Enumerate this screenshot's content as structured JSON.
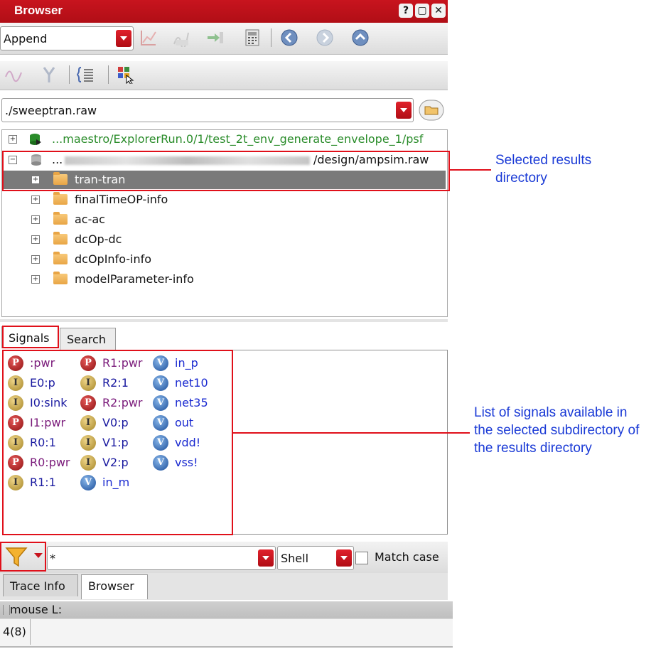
{
  "window": {
    "title": "Browser"
  },
  "title_buttons": [
    "?",
    "▢",
    "✕"
  ],
  "toolbar1": {
    "mode_value": "Append"
  },
  "path_combo": {
    "value": "./sweeptran.raw"
  },
  "tree": {
    "rows": [
      {
        "label": "...maestro/ExplorerRun.0/1/test_2t_env_generate_envelope_1/psf"
      },
      {
        "prefix": "...",
        "label": "/design/ampsim.raw"
      },
      {
        "label": "tran-tran"
      },
      {
        "label": "finalTimeOP-info"
      },
      {
        "label": "ac-ac"
      },
      {
        "label": "dcOp-dc"
      },
      {
        "label": "dcOpInfo-info"
      },
      {
        "label": "modelParameter-info"
      }
    ]
  },
  "tabs": {
    "signals": "Signals",
    "search": "Search"
  },
  "signals": {
    "col1": [
      {
        "type": "P",
        "name": ":pwr"
      },
      {
        "type": "I",
        "name": "E0:p"
      },
      {
        "type": "I",
        "name": "I0:sink"
      },
      {
        "type": "P",
        "name": "I1:pwr"
      },
      {
        "type": "I",
        "name": "R0:1"
      },
      {
        "type": "P",
        "name": "R0:pwr"
      },
      {
        "type": "I",
        "name": "R1:1"
      }
    ],
    "col2": [
      {
        "type": "P",
        "name": "R1:pwr"
      },
      {
        "type": "I",
        "name": "R2:1"
      },
      {
        "type": "P",
        "name": "R2:pwr"
      },
      {
        "type": "I",
        "name": "V0:p"
      },
      {
        "type": "I",
        "name": "V1:p"
      },
      {
        "type": "I",
        "name": "V2:p"
      },
      {
        "type": "V",
        "name": "in_m"
      }
    ],
    "col3": [
      {
        "type": "V",
        "name": "in_p"
      },
      {
        "type": "V",
        "name": "net10"
      },
      {
        "type": "V",
        "name": "net35"
      },
      {
        "type": "V",
        "name": "out"
      },
      {
        "type": "V",
        "name": "vdd!"
      },
      {
        "type": "V",
        "name": "vss!"
      }
    ],
    "colors": {
      "P": "#7a1a7a",
      "I": "#1a1aa0",
      "V": "#1a2ad0"
    }
  },
  "filter": {
    "pattern": "*",
    "syntax": "Shell",
    "match_case": "Match case"
  },
  "bottom_tabs": {
    "trace_info": "Trace Info",
    "browser": "Browser"
  },
  "status": {
    "mouse": "mouse L:",
    "count": "4(8)"
  },
  "callouts": {
    "selected": "Selected results\ndirectory",
    "signals_list": "List of signals available in\nthe selected subdirectory of\nthe results directory"
  }
}
